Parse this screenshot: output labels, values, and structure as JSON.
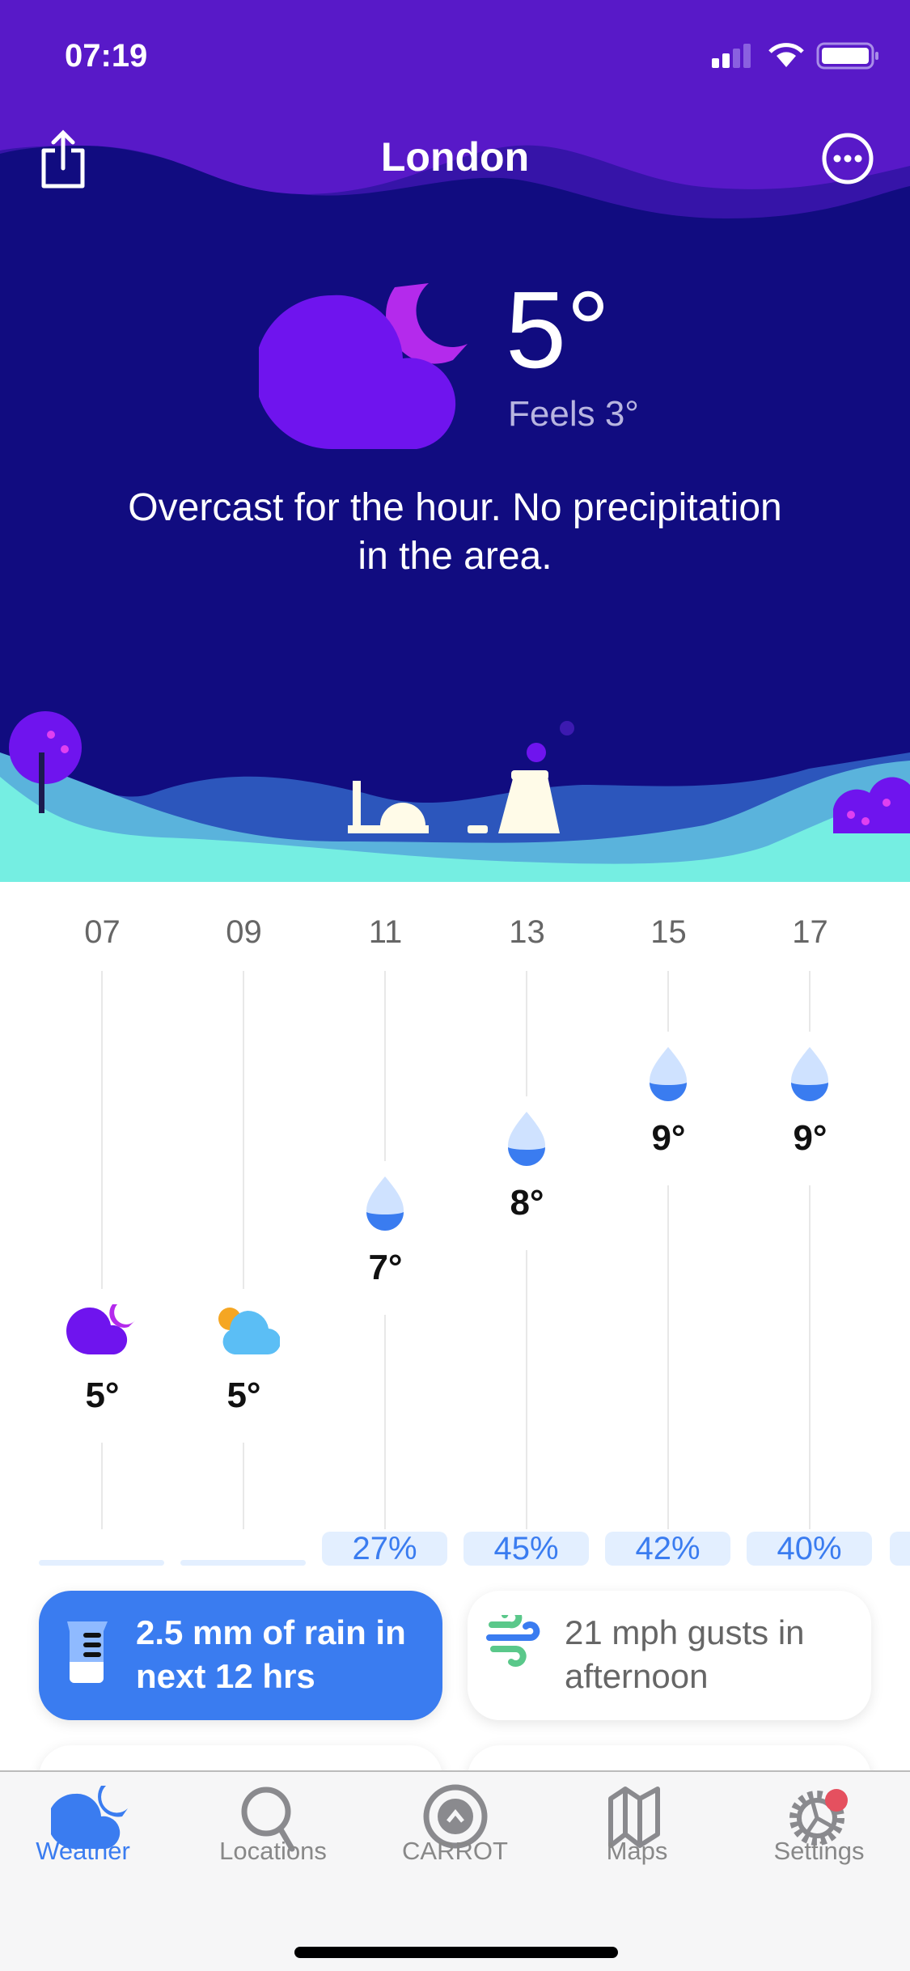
{
  "status_bar": {
    "time": "07:19"
  },
  "header": {
    "title": "London",
    "share_icon": "share-icon",
    "more_icon": "ellipsis-circle-icon"
  },
  "current": {
    "icon": "cloud-moon-icon",
    "temperature": "5°",
    "feels_like": "Feels 3°",
    "summary": "Overcast for the hour. No precipitation in the area."
  },
  "hourly": [
    {
      "hour": "07",
      "icon": "cloud-moon-icon",
      "temp": "5°",
      "precip": null
    },
    {
      "hour": "09",
      "icon": "cloud-sun-icon",
      "temp": "5°",
      "precip": null
    },
    {
      "hour": "11",
      "icon": "raindrop-icon",
      "temp": "7°",
      "precip": "27%"
    },
    {
      "hour": "13",
      "icon": "raindrop-icon",
      "temp": "8°",
      "precip": "45%"
    },
    {
      "hour": "15",
      "icon": "raindrop-icon",
      "temp": "9°",
      "precip": "42%"
    },
    {
      "hour": "17",
      "icon": "raindrop-icon",
      "temp": "9°",
      "precip": "40%"
    }
  ],
  "cards": {
    "rain": {
      "text": "2.5 mm of rain in next 12 hrs",
      "icon": "rain-gauge-icon"
    },
    "wind": {
      "text": "21 mph gusts in afternoon",
      "icon": "wind-icon"
    }
  },
  "tabs": [
    {
      "label": "Weather",
      "active": true
    },
    {
      "label": "Locations"
    },
    {
      "label": "CARROT"
    },
    {
      "label": "Maps"
    },
    {
      "label": "Settings",
      "badge": true
    }
  ],
  "colors": {
    "accent": "#3A7CF0",
    "hero_bg": "#110C80",
    "header_bg": "#5819C8",
    "cloud": "#6F14EE",
    "moon": "#B42AEC"
  }
}
